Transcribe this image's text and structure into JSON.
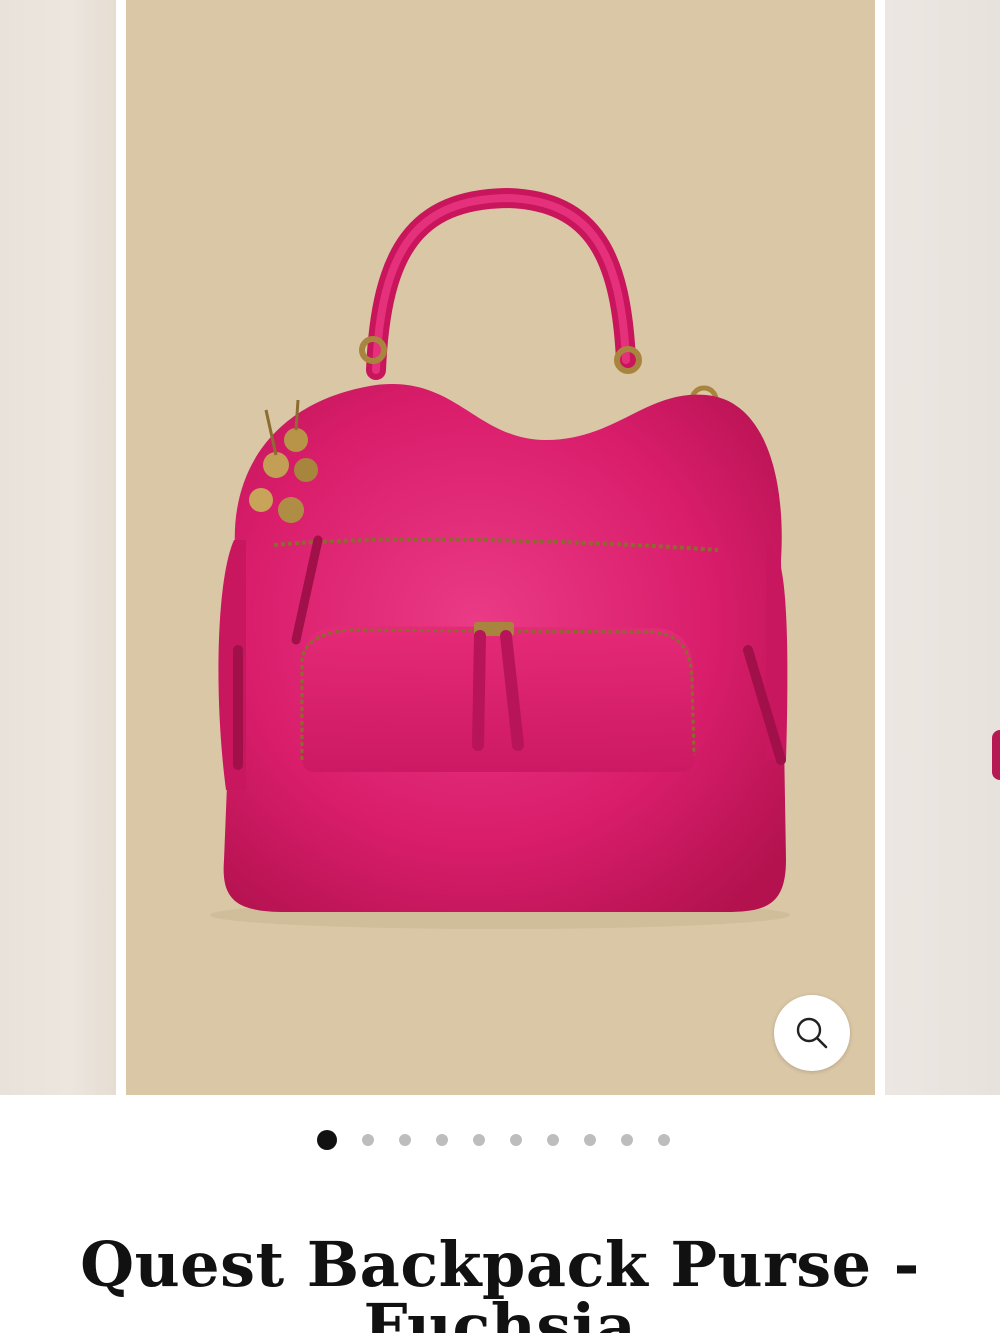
{
  "product": {
    "title": "Quest Backpack Purse - Fuchsia",
    "image_alt": "Fuchsia leather backpack purse with gold flower charm"
  },
  "gallery": {
    "slide_count": 10,
    "active_index": 0,
    "zoom_icon": "search-icon"
  },
  "colors": {
    "backdrop": "#dac7a6",
    "bag": "#e0226e",
    "active_dot": "#111111",
    "inactive_dot": "#bdbdbd"
  }
}
